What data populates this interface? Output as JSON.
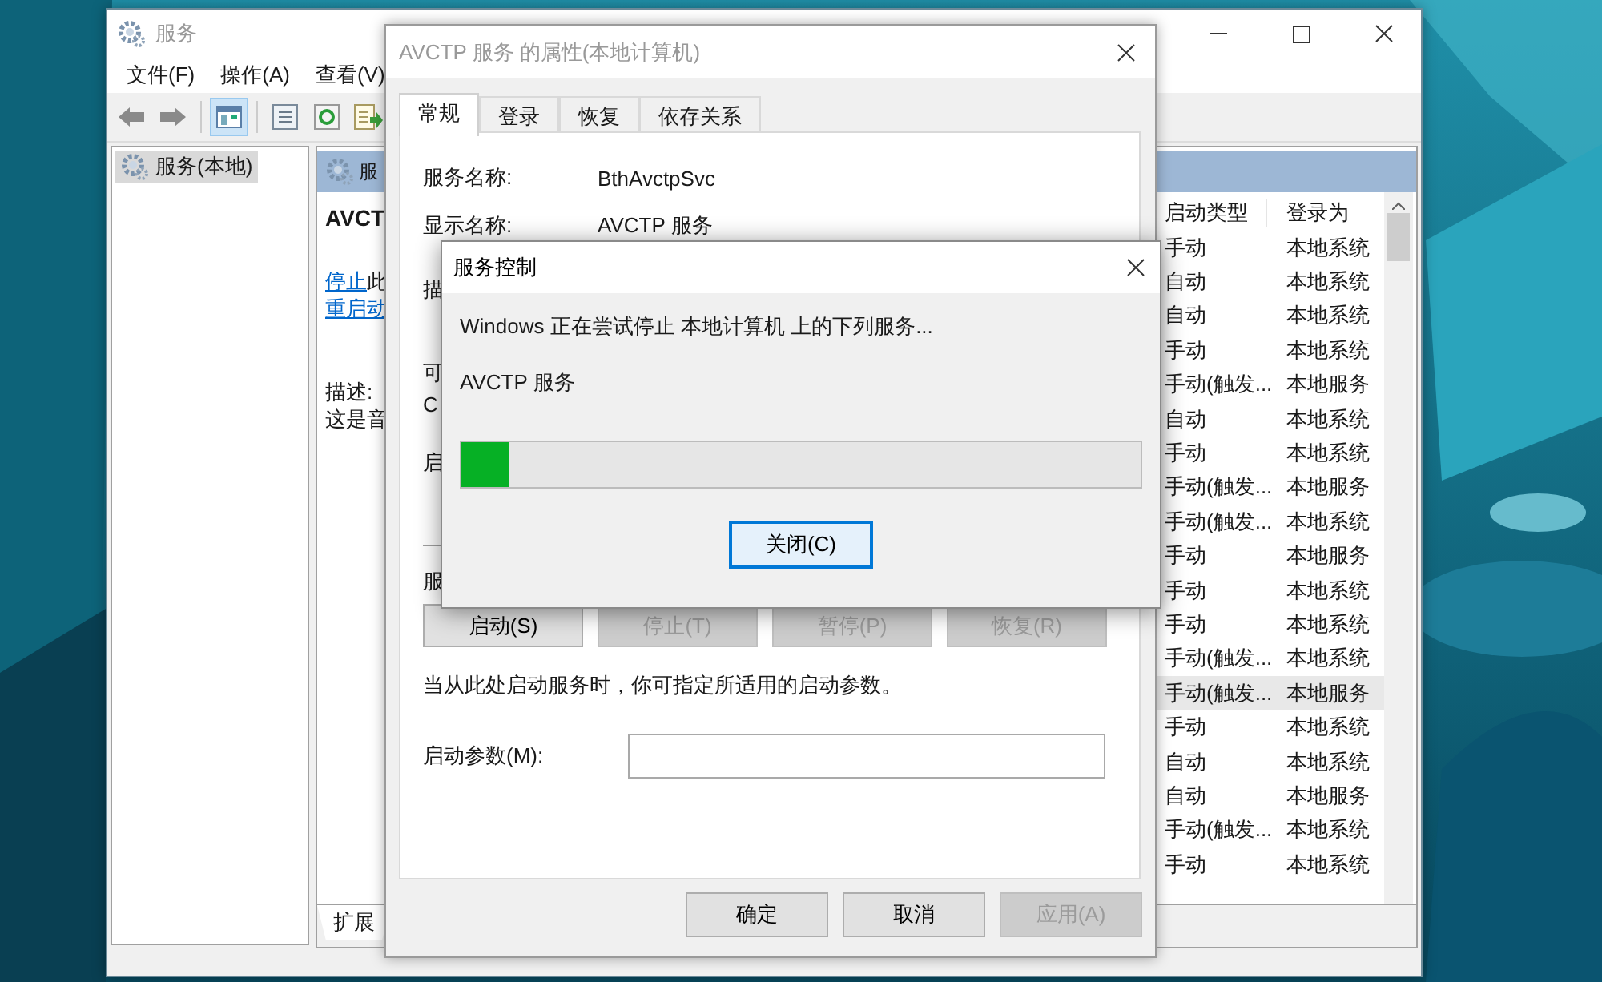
{
  "main_window": {
    "title": "服务",
    "menu": [
      "文件(F)",
      "操作(A)",
      "查看(V)"
    ],
    "tree": [
      {
        "label": "服务(本地)",
        "selected": true
      }
    ],
    "header": "服",
    "detail": {
      "name": "AVCT",
      "links": [
        {
          "link": "停止",
          "rest": "此"
        },
        {
          "link": "重启动"
        }
      ],
      "description_label": "描述:",
      "description": "这是音"
    },
    "bottom_tabs": [
      {
        "label": "扩展",
        "selected": true
      }
    ],
    "table": {
      "columns": [
        "启动类型",
        "登录为"
      ],
      "rows": [
        {
          "startup": "手动",
          "logon": "本地系统",
          "selected": false
        },
        {
          "startup": "自动",
          "logon": "本地系统",
          "selected": false
        },
        {
          "startup": "自动",
          "logon": "本地系统",
          "selected": false
        },
        {
          "startup": "手动",
          "logon": "本地系统",
          "selected": false
        },
        {
          "startup": "手动(触发...",
          "logon": "本地服务",
          "selected": false
        },
        {
          "startup": "自动",
          "logon": "本地系统",
          "selected": false
        },
        {
          "startup": "手动",
          "logon": "本地系统",
          "selected": false
        },
        {
          "startup": "手动(触发...",
          "logon": "本地服务",
          "selected": false
        },
        {
          "startup": "手动(触发...",
          "logon": "本地系统",
          "selected": false
        },
        {
          "startup": "手动",
          "logon": "本地服务",
          "selected": false
        },
        {
          "startup": "手动",
          "logon": "本地系统",
          "selected": false
        },
        {
          "startup": "手动",
          "logon": "本地系统",
          "selected": false
        },
        {
          "startup": "手动(触发...",
          "logon": "本地系统",
          "selected": false
        },
        {
          "startup": "手动(触发...",
          "logon": "本地服务",
          "selected": true
        },
        {
          "startup": "手动",
          "logon": "本地系统",
          "selected": false
        },
        {
          "startup": "自动",
          "logon": "本地系统",
          "selected": false
        },
        {
          "startup": "自动",
          "logon": "本地服务",
          "selected": false
        },
        {
          "startup": "手动(触发...",
          "logon": "本地系统",
          "selected": false
        },
        {
          "startup": "手动",
          "logon": "本地系统",
          "selected": false
        }
      ]
    }
  },
  "properties_dialog": {
    "title": "AVCTP 服务 的属性(本地计算机)",
    "tabs": [
      {
        "label": "常规",
        "selected": true
      },
      {
        "label": "登录",
        "selected": false
      },
      {
        "label": "恢复",
        "selected": false
      },
      {
        "label": "依存关系",
        "selected": false
      }
    ],
    "fields": [
      {
        "label": "服务名称:",
        "value": "BthAvctpSvc"
      },
      {
        "label": "显示名称:",
        "value": "AVCTP 服务"
      }
    ],
    "obscured_labels": [
      "描",
      "可",
      "C",
      "启"
    ],
    "status_label": "服",
    "buttons": [
      {
        "label": "启动(S)",
        "disabled": false
      },
      {
        "label": "停止(T)",
        "disabled": true
      },
      {
        "label": "暂停(P)",
        "disabled": true
      },
      {
        "label": "恢复(R)",
        "disabled": true
      }
    ],
    "hint": "当从此处启动服务时，你可指定所适用的启动参数。",
    "param_label": "启动参数(M):",
    "footer_buttons": [
      {
        "label": "确定",
        "disabled": false
      },
      {
        "label": "取消",
        "disabled": false
      },
      {
        "label": "应用(A)",
        "disabled": true
      }
    ]
  },
  "control_dialog": {
    "title": "服务控制",
    "message": "Windows 正在尝试停止 本地计算机 上的下列服务...",
    "service": "AVCTP 服务",
    "progress": {
      "level": 0.07
    },
    "buttons": [
      {
        "label": "关闭(C)",
        "default": true
      }
    ]
  }
}
